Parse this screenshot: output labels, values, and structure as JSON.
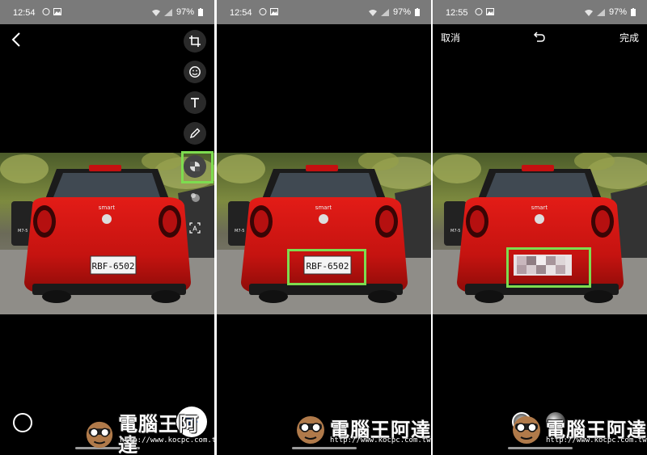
{
  "status_bars": [
    {
      "time": "12:54",
      "battery": "97%"
    },
    {
      "time": "12:54",
      "battery": "97%"
    },
    {
      "time": "12:55",
      "battery": "97%"
    }
  ],
  "photo": {
    "car_badge": "smart",
    "plate": "RBF-6502",
    "side_plate": "M7-5"
  },
  "editor_toolbar": {
    "tools": [
      "crop-icon",
      "sticker-icon",
      "text-icon",
      "pen-icon",
      "blur-icon",
      "eraser-icon",
      "auto-text-icon"
    ]
  },
  "blur_editor": {
    "cancel_label": "取消",
    "done_label": "完成"
  },
  "watermark": {
    "text": "電腦王阿達",
    "url": "http://www.kocpc.com.tw"
  },
  "colors": {
    "highlight": "#7ddc4f",
    "send_arrow": "#1e6cff",
    "status_bar": "#7a7a7a"
  }
}
